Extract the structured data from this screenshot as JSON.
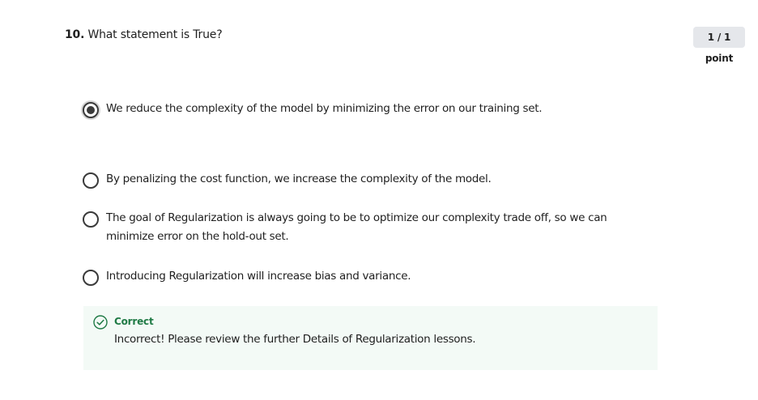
{
  "question": {
    "number": "10.",
    "text": "What statement is True?",
    "points": "1 / 1 point"
  },
  "options": [
    {
      "label": "We reduce the complexity of the model by minimizing the error on our training set.",
      "selected": true
    },
    {
      "label": "By penalizing the cost function, we increase the complexity of the model.",
      "selected": false
    },
    {
      "label": "The goal of Regularization is always going to be to optimize our complexity trade off, so we can minimize error on the hold-out set.",
      "selected": false
    },
    {
      "label": "Introducing Regularization will increase bias and variance.",
      "selected": false
    }
  ],
  "feedback": {
    "status": "Correct",
    "message": "Incorrect! Please review the further Details of Regularization lessons.",
    "icon": "check-circle-icon",
    "color": "#1f7a45",
    "background": "#f3faf6"
  }
}
